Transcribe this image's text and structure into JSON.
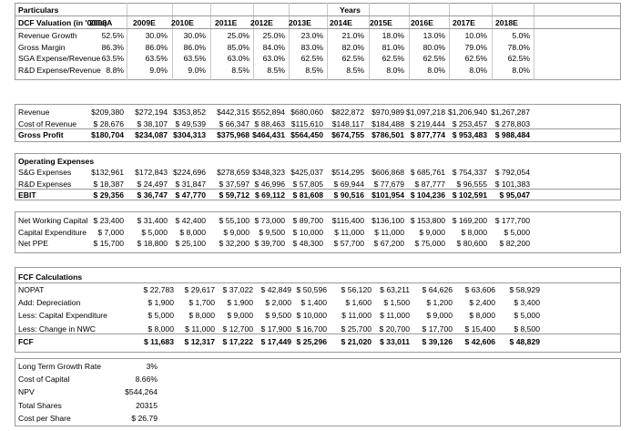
{
  "header": {
    "particulars": "Particulars",
    "years": "Years",
    "dcf_title": "DCF Valuation (in '000s)",
    "year_labels": [
      "2008A",
      "2009E",
      "2010E",
      "2011E",
      "2012E",
      "2013E",
      "2014E",
      "2015E",
      "2016E",
      "2017E",
      "2018E"
    ]
  },
  "assumptions": [
    {
      "label": "Revenue Growth",
      "values": [
        "52.5%",
        "30.0%",
        "30.0%",
        "25.0%",
        "25.0%",
        "23.0%",
        "21.0%",
        "18.0%",
        "13.0%",
        "10.0%",
        "5.0%"
      ]
    },
    {
      "label": "Gross Margin",
      "values": [
        "86.3%",
        "86.0%",
        "86.0%",
        "85.0%",
        "84.0%",
        "83.0%",
        "82.0%",
        "81.0%",
        "80.0%",
        "79.0%",
        "78.0%"
      ]
    },
    {
      "label": "SGA Expense/Revenue",
      "values": [
        "63.5%",
        "63.5%",
        "63.5%",
        "63.0%",
        "63.0%",
        "62.5%",
        "62.5%",
        "62.5%",
        "62.5%",
        "62.5%",
        "62.5%"
      ]
    },
    {
      "label": "R&D Expense/Revenue",
      "values": [
        "8.8%",
        "9.0%",
        "9.0%",
        "8.5%",
        "8.5%",
        "8.5%",
        "8.5%",
        "8.0%",
        "8.0%",
        "8.0%",
        "8.0%"
      ]
    }
  ],
  "revenue_block": [
    {
      "label": "Revenue",
      "values": [
        "$209,380",
        "$272,194",
        "$353,852",
        "$442,315",
        "$552,894",
        "$680,060",
        "$822,872",
        "$970,989",
        "$1,097,218",
        "$1,206,940",
        "$1,267,287"
      ],
      "bold": false
    },
    {
      "label": "Cost of Revenue",
      "values": [
        "$ 28,676",
        "$ 38,107",
        "$ 49,539",
        "$ 66,347",
        "$ 88,463",
        "$115,610",
        "$148,117",
        "$184,488",
        "$ 219,444",
        "$ 253,457",
        "$ 278,803"
      ],
      "bold": false
    },
    {
      "label": "Gross Profit",
      "values": [
        "$180,704",
        "$234,087",
        "$304,313",
        "$375,968",
        "$464,431",
        "$564,450",
        "$674,755",
        "$786,501",
        "$ 877,774",
        "$ 953,483",
        "$ 988,484"
      ],
      "bold": true
    }
  ],
  "opex_block": {
    "heading": "Operating Expenses",
    "rows": [
      {
        "label": "S&G Expenses",
        "values": [
          "$132,961",
          "$172,843",
          "$224,696",
          "$278,659",
          "$348,323",
          "$425,037",
          "$514,295",
          "$606,868",
          "$ 685,761",
          "$ 754,337",
          "$ 792,054"
        ],
        "bold": false
      },
      {
        "label": "R&D Expenses",
        "values": [
          "$ 18,387",
          "$ 24,497",
          "$ 31,847",
          "$ 37,597",
          "$ 46,996",
          "$ 57,805",
          "$ 69,944",
          "$ 77,679",
          "$ 87,777",
          "$ 96,555",
          "$ 101,383"
        ],
        "bold": false
      },
      {
        "label": "EBIT",
        "values": [
          "$ 29,356",
          "$ 36,747",
          "$ 47,770",
          "$ 59,712",
          "$ 69,112",
          "$ 81,608",
          "$ 90,516",
          "$101,954",
          "$ 104,236",
          "$ 102,591",
          "$ 95,047"
        ],
        "bold": true
      }
    ]
  },
  "capital_block": [
    {
      "label": "Net Working Capital",
      "values": [
        "$ 23,400",
        "$ 31,400",
        "$ 42,400",
        "$ 55,100",
        "$ 73,000",
        "$ 89,700",
        "$115,400",
        "$136,100",
        "$ 153,800",
        "$ 169,200",
        "$ 177,700"
      ]
    },
    {
      "label": "Capital Expenditure",
      "values": [
        "$ 7,000",
        "$ 5,000",
        "$ 8,000",
        "$ 9,000",
        "$ 9,500",
        "$ 10,000",
        "$ 11,000",
        "$ 11,000",
        "$ 9,000",
        "$ 8,000",
        "$ 5,000"
      ]
    },
    {
      "label": "Net PPE",
      "values": [
        "$ 15,700",
        "$ 18,800",
        "$ 25,100",
        "$ 32,200",
        "$ 39,700",
        "$ 48,300",
        "$ 57,700",
        "$ 67,200",
        "$ 75,000",
        "$ 80,600",
        "$ 82,200"
      ]
    }
  ],
  "fcf_block": {
    "heading": "FCF Calculations",
    "rows": [
      {
        "label": "NOPAT",
        "values": [
          "$ 22,783",
          "$ 29,617",
          "$ 37,022",
          "$ 42,849",
          "$ 50,596",
          "$ 56,120",
          "$ 63,211",
          "$ 64,626",
          "$ 63,606",
          "$ 58,929"
        ],
        "bold": false
      },
      {
        "label": "Add: Depreciation",
        "values": [
          "$ 1,900",
          "$ 1,700",
          "$ 1,900",
          "$ 2,000",
          "$ 1,400",
          "$ 1,600",
          "$ 1,500",
          "$ 1,200",
          "$ 2,400",
          "$ 3,400"
        ],
        "bold": false
      },
      {
        "label": "Less: Capital Expenditure",
        "values": [
          "$ 5,000",
          "$ 8,000",
          "$ 9,000",
          "$ 9,500",
          "$ 10,000",
          "$ 11,000",
          "$ 11,000",
          "$ 9,000",
          "$ 8,000",
          "$ 5,000"
        ],
        "bold": false
      },
      {
        "label": "Less: Change in NWC",
        "values": [
          "$ 8,000",
          "$ 11,000",
          "$ 12,700",
          "$ 17,900",
          "$ 16,700",
          "$ 25,700",
          "$ 20,700",
          "$ 17,700",
          "$ 15,400",
          "$ 8,500"
        ],
        "bold": false
      },
      {
        "label": "FCF",
        "values": [
          "$ 11,683",
          "$ 12,317",
          "$ 17,222",
          "$ 17,449",
          "$ 25,296",
          "$ 21,020",
          "$ 33,011",
          "$ 39,126",
          "$ 42,606",
          "$ 48,829"
        ],
        "bold": true
      }
    ]
  },
  "valuation": [
    {
      "label": "Long Term Growth Rate",
      "value": "3%"
    },
    {
      "label": "Cost of Capital",
      "value": "8.66%"
    },
    {
      "label": "NPV",
      "value": "$544,264"
    },
    {
      "label": "Total Shares",
      "value": "20315"
    },
    {
      "label": "Cost per Share",
      "value": "$ 26.79"
    }
  ]
}
